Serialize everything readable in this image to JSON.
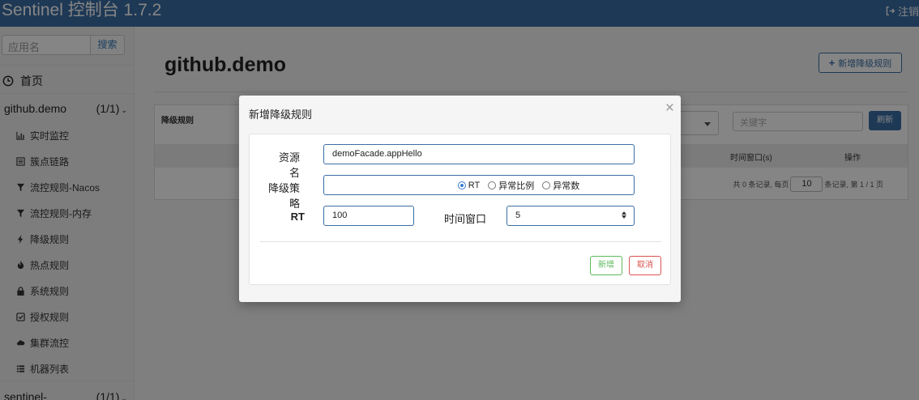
{
  "header": {
    "brand": "Sentinel 控制台 1.7.2",
    "logout_label": "注销"
  },
  "sidebar": {
    "search_placeholder": "应用名",
    "search_button": "搜索",
    "home_label": "首页",
    "app": {
      "name": "github.demo",
      "count": "(1/1)"
    },
    "menu": [
      {
        "label": "实时监控",
        "icon": "bar-chart-icon"
      },
      {
        "label": "簇点链路",
        "icon": "list-icon"
      },
      {
        "label": "流控规则-Nacos",
        "icon": "filter-icon"
      },
      {
        "label": "流控规则-内存",
        "icon": "filter-icon"
      },
      {
        "label": "降级规则",
        "icon": "flash-icon"
      },
      {
        "label": "热点规则",
        "icon": "fire-icon"
      },
      {
        "label": "系统规则",
        "icon": "lock-icon"
      },
      {
        "label": "授权规则",
        "icon": "check-icon"
      },
      {
        "label": "集群流控",
        "icon": "cloud-icon"
      },
      {
        "label": "机器列表",
        "icon": "th-list-icon"
      }
    ],
    "app2": {
      "name": "sentinel-dashboard",
      "count": "(1/1)"
    }
  },
  "main": {
    "title": "github.demo",
    "add_rule_label": "新增降级规则",
    "panel_title": "降级规则",
    "keyword_placeholder": "关键字",
    "refresh_label": "刷新",
    "columns": [
      "时间窗口(s)",
      "操作"
    ],
    "pager": {
      "prefix": "共 0 条记录, 每页",
      "page_size": "10",
      "suffix": "条记录, 第 1 / 1 页"
    }
  },
  "modal": {
    "title": "新增降级规则",
    "close": "×",
    "resource_label": "资源名",
    "resource_value": "demoFacade.appHello",
    "strategy_label": "降级策略",
    "strategies": [
      {
        "label": "RT",
        "selected": true
      },
      {
        "label": "异常比例",
        "selected": false
      },
      {
        "label": "异常数",
        "selected": false
      }
    ],
    "rt_label": "RT",
    "rt_value": "100",
    "window_label": "时间窗口",
    "window_value": "5",
    "add_label": "新增",
    "cancel_label": "取消"
  },
  "colors": {
    "primary": "#3a6ea5",
    "success": "#5cb85c",
    "danger": "#d9534f"
  }
}
